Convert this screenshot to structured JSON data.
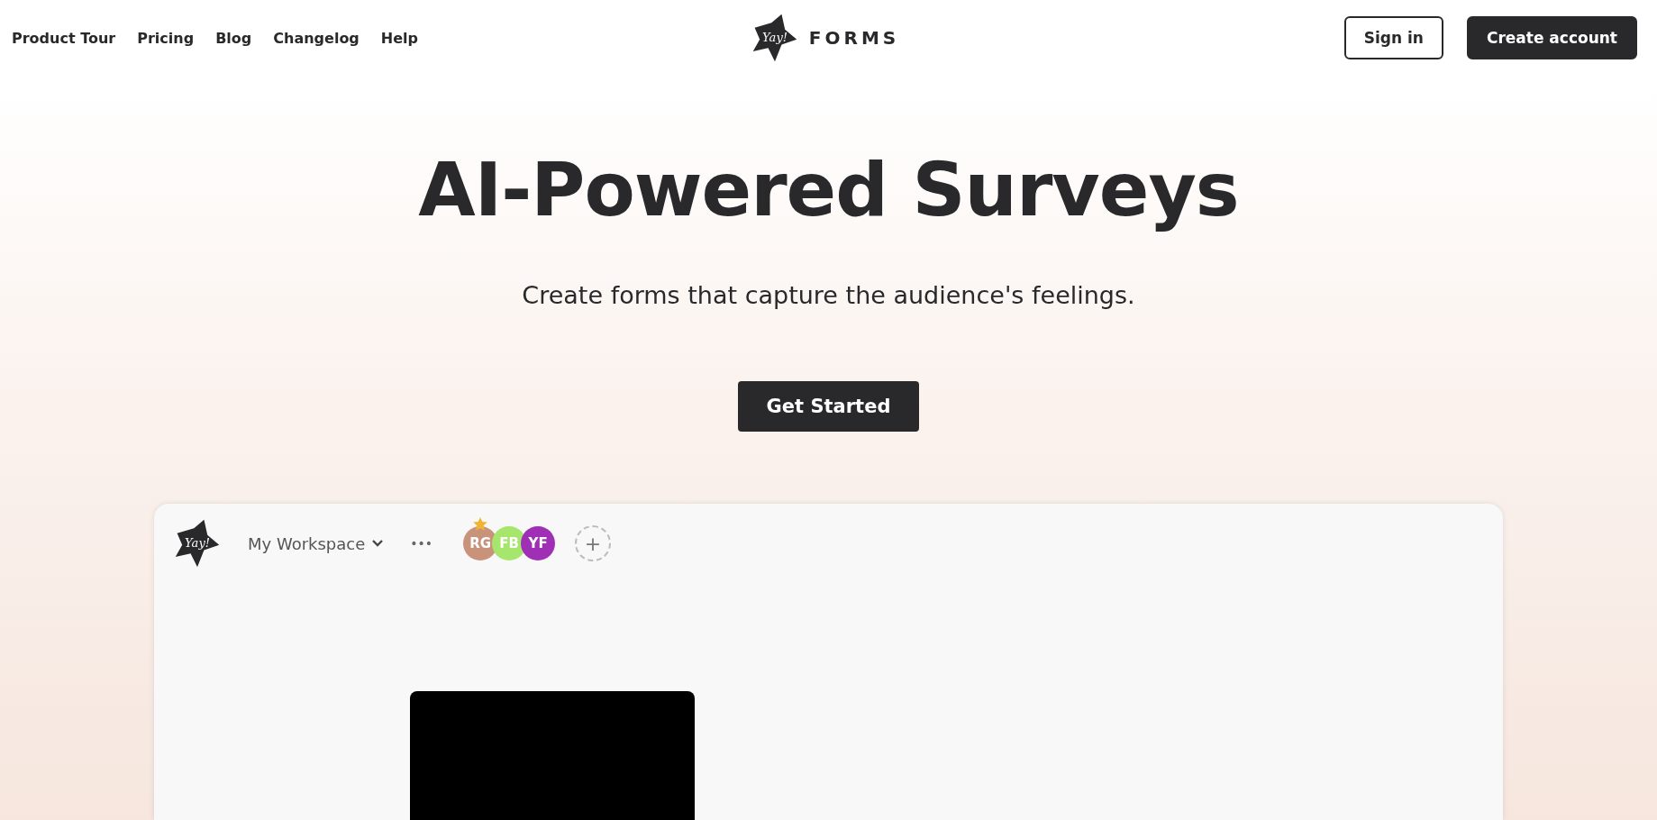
{
  "nav": {
    "links": [
      "Product Tour",
      "Pricing",
      "Blog",
      "Changelog",
      "Help"
    ],
    "logo": {
      "badge": "Yay!",
      "wordmark": "FORMS"
    },
    "buttons": [
      {
        "label": "Sign in",
        "kind": "outline"
      },
      {
        "label": "Create account",
        "kind": "solid"
      }
    ]
  },
  "hero": {
    "title": "AI-Powered Surveys",
    "subtitle": "Create forms that capture the audience's feelings.",
    "cta": "Get Started"
  },
  "app_preview": {
    "logo": "Yay!",
    "workspace": "My Workspace",
    "more": "•••",
    "members": [
      {
        "initials": "RG",
        "color": "#c8937a",
        "owner": true
      },
      {
        "initials": "FB",
        "color": "#a6e66c",
        "owner": false
      },
      {
        "initials": "YF",
        "color": "#9f2fb5",
        "owner": false
      }
    ],
    "add": "+"
  }
}
